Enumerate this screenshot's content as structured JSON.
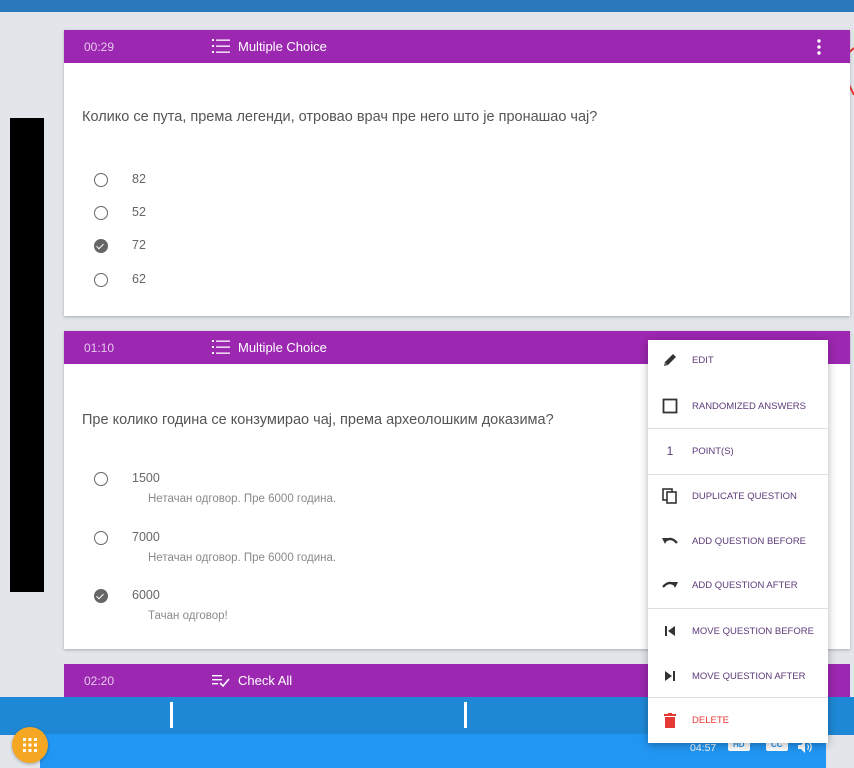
{
  "cards": [
    {
      "time": "00:29",
      "type_label": "Multiple Choice",
      "question": "Колико се пута, према легенди, отровао врач пре него што је пронашао чај?",
      "options": [
        {
          "text": "82",
          "checked": false
        },
        {
          "text": "52",
          "checked": false
        },
        {
          "text": "72",
          "checked": true
        },
        {
          "text": "62",
          "checked": false
        }
      ]
    },
    {
      "time": "01:10",
      "type_label": "Multiple Choice",
      "question": "Пре колико година се конзумирао чај, према археолошким доказима?",
      "options": [
        {
          "text": "1500",
          "feedback": "Нетачан одговор. Пре 6000 година.",
          "checked": false
        },
        {
          "text": "7000",
          "feedback": "Нетачан одговор. Пре 6000 година.",
          "checked": false
        },
        {
          "text": "6000",
          "feedback": "Тачан одговор!",
          "checked": true
        }
      ]
    },
    {
      "time": "02:20",
      "type_label": "Check All"
    }
  ],
  "menu": {
    "edit": "EDIT",
    "randomized": "RANDOMIZED ANSWERS",
    "points_value": "1",
    "points": "POINT(S)",
    "duplicate": "DUPLICATE QUESTION",
    "add_before": "ADD QUESTION BEFORE",
    "add_after": "ADD QUESTION AFTER",
    "move_before": "MOVE QUESTION BEFORE",
    "move_after": "MOVE QUESTION AFTER",
    "delete": "DELETE"
  },
  "player": {
    "time": "04:57",
    "hd": "HD",
    "cc": "CC"
  },
  "colors": {
    "header": "#9c27b0",
    "player_bar": "#2196f3",
    "fab": "#f5a623",
    "delete": "#e53935"
  },
  "icons": [
    "list-icon",
    "check-list-icon",
    "more-vert-icon",
    "pencil-icon",
    "checkbox-icon",
    "copy-icon",
    "undo-icon",
    "redo-icon",
    "skip-previous-icon",
    "skip-next-icon",
    "trash-icon",
    "apps-icon",
    "volume-icon"
  ]
}
